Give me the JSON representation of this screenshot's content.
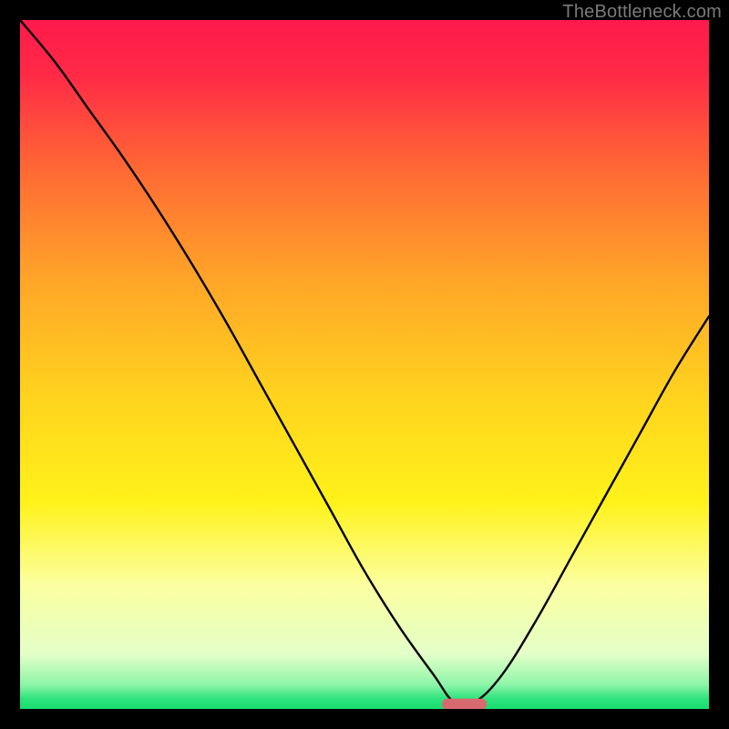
{
  "watermark": "TheBottleneck.com",
  "chart_data": {
    "type": "line",
    "title": "",
    "xlabel": "",
    "ylabel": "",
    "xlim": [
      0,
      100
    ],
    "ylim": [
      0,
      100
    ],
    "grid": false,
    "series": [
      {
        "name": "bottleneck-curve",
        "x": [
          0,
          5,
          10,
          15,
          20,
          25,
          30,
          35,
          40,
          45,
          50,
          55,
          60,
          63,
          66,
          70,
          75,
          80,
          85,
          90,
          95,
          100
        ],
        "values": [
          100,
          94,
          87,
          80,
          72.5,
          64.5,
          56,
          47,
          38,
          29,
          20,
          12,
          5,
          1,
          1,
          5,
          13,
          22,
          31,
          40,
          49,
          57
        ]
      }
    ],
    "marker": {
      "name": "optimum-marker",
      "shape": "roundrect",
      "color": "#d86a6f",
      "x_center": 64.5,
      "y_center": 0.7,
      "width": 6.5,
      "height": 1.6
    },
    "background_gradient": {
      "type": "vertical",
      "stops": [
        {
          "y_percent": 0,
          "color": "#ff1a4b"
        },
        {
          "y_percent": 8,
          "color": "#ff2a46"
        },
        {
          "y_percent": 22,
          "color": "#ff6a34"
        },
        {
          "y_percent": 38,
          "color": "#ffa628"
        },
        {
          "y_percent": 55,
          "color": "#ffd41e"
        },
        {
          "y_percent": 70,
          "color": "#fff21a"
        },
        {
          "y_percent": 82,
          "color": "#fbffa0"
        },
        {
          "y_percent": 92,
          "color": "#e4ffc8"
        },
        {
          "y_percent": 96.5,
          "color": "#8cf5a8"
        },
        {
          "y_percent": 98.5,
          "color": "#2fe37d"
        },
        {
          "y_percent": 100,
          "color": "#16dd72"
        }
      ]
    }
  }
}
